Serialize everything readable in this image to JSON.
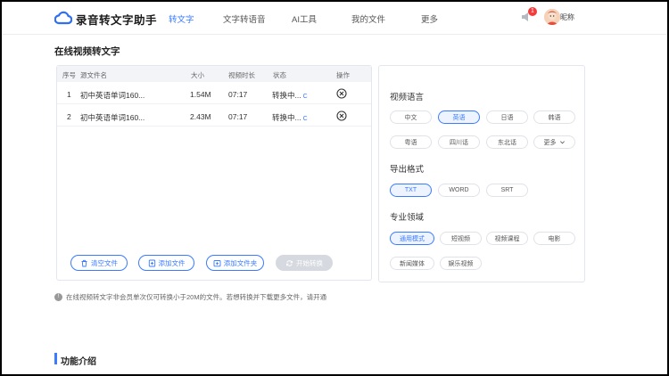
{
  "header": {
    "brand": "录音转文字助手",
    "nav": [
      "转文字",
      "文字转语音",
      "AI工具",
      "我的文件",
      "更多"
    ],
    "notification_count": "1",
    "nickname": "昵称"
  },
  "page": {
    "title": "在线视频转文字"
  },
  "table": {
    "headers": {
      "index": "序号",
      "name": "源文件名",
      "size": "大小",
      "duration": "视频时长",
      "status": "状态",
      "action": "操作"
    },
    "rows": [
      {
        "index": "1",
        "name": "初中英语单词160...",
        "size": "1.54M",
        "duration": "07:17",
        "status": "转换中...",
        "status_icon": "C"
      },
      {
        "index": "2",
        "name": "初中英语单词160...",
        "size": "2.43M",
        "duration": "07:17",
        "status": "转换中...",
        "status_icon": "C"
      }
    ]
  },
  "buttons": {
    "clear": "清空文件",
    "add_file": "添加文件",
    "add_folder": "添加文件夹",
    "start": "开始转换"
  },
  "options": {
    "language_title": "视频语言",
    "languages": [
      "中文",
      "英语",
      "日语",
      "韩语",
      "粤语",
      "四川话",
      "东北话",
      "更多"
    ],
    "language_selected": "英语",
    "format_title": "导出格式",
    "formats": [
      "TXT",
      "WORD",
      "SRT"
    ],
    "format_selected": "TXT",
    "domain_title": "专业领域",
    "domains": [
      "通用模式",
      "短视频",
      "视频课程",
      "电影",
      "新闻媒体",
      "娱乐视频"
    ],
    "domain_selected": "通用模式"
  },
  "note": "在线视频转文字非会员单次仅可转换小于20M的文件。若想转换并下载更多文件，请开通",
  "feature_section": "功能介绍",
  "colors": {
    "accent": "#3a7bff",
    "badge": "#f23b3b"
  }
}
